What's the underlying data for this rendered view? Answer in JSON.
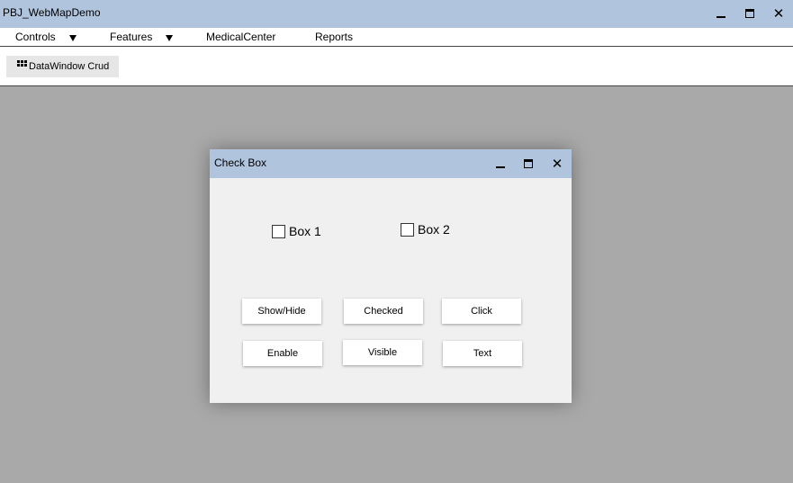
{
  "window": {
    "title": "PBJ_WebMapDemo"
  },
  "menu": {
    "items": [
      {
        "label": "Controls",
        "has_dropdown": true
      },
      {
        "label": "Features",
        "has_dropdown": true
      },
      {
        "label": "MedicalCenter",
        "has_dropdown": false
      },
      {
        "label": "Reports",
        "has_dropdown": false
      }
    ]
  },
  "toolbar": {
    "tab_label": "DataWindow Crud",
    "tab_icon": "grid-icon"
  },
  "dialog": {
    "title": "Check Box",
    "checkboxes": [
      {
        "label": "Box 1",
        "checked": false
      },
      {
        "label": "Box 2",
        "checked": false
      }
    ],
    "buttons": [
      "Show/Hide",
      "Checked",
      "Click",
      "Enable",
      "Visible",
      "Text"
    ]
  },
  "colors": {
    "titlebar": "#b0c4de",
    "background": "#a9a9a9",
    "dialog_body": "#f0f0f0"
  }
}
